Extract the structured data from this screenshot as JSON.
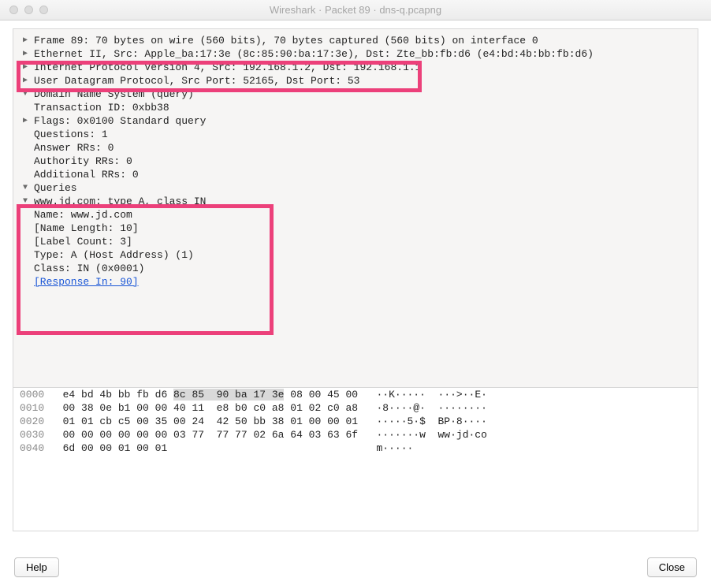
{
  "window": {
    "title": "Wireshark · Packet 89 · dns-q.pcapng"
  },
  "tree": {
    "frame": "Frame 89: 70 bytes on wire (560 bits), 70 bytes captured (560 bits) on interface 0",
    "eth": "Ethernet II, Src: Apple_ba:17:3e (8c:85:90:ba:17:3e), Dst: Zte_bb:fb:d6 (e4:bd:4b:bb:fb:d6)",
    "ip": "Internet Protocol Version 4, Src: 192.168.1.2, Dst: 192.168.1.1",
    "udp": "User Datagram Protocol, Src Port: 52165, Dst Port: 53",
    "dns": "Domain Name System (query)",
    "dns_txn": "Transaction ID: 0xbb38",
    "dns_flags": "Flags: 0x0100 Standard query",
    "dns_qcount": "Questions: 1",
    "dns_ancount": "Answer RRs: 0",
    "dns_nscount": "Authority RRs: 0",
    "dns_arcount": "Additional RRs: 0",
    "dns_queries": "Queries",
    "dns_q_summary": "www.jd.com: type A, class IN",
    "dns_q_name": "Name: www.jd.com",
    "dns_q_namelen": "[Name Length: 10]",
    "dns_q_labelcnt": "[Label Count: 3]",
    "dns_q_type": "Type: A (Host Address) (1)",
    "dns_q_class": "Class: IN (0x0001)",
    "dns_resp_in": "[Response In: 90]"
  },
  "hex": {
    "lines": [
      {
        "offset": "0000",
        "hex": "e4 bd 4b bb fb d6 8c 85  90 ba 17 3e 08 00 45 00",
        "ascii": "··K·····  ···>··E·",
        "sel": [
          18,
          35
        ]
      },
      {
        "offset": "0010",
        "hex": "00 38 0e b1 00 00 40 11  e8 b0 c0 a8 01 02 c0 a8",
        "ascii": "·8····@·  ········"
      },
      {
        "offset": "0020",
        "hex": "01 01 cb c5 00 35 00 24  42 50 bb 38 01 00 00 01",
        "ascii": "·····5·$  BP·8····"
      },
      {
        "offset": "0030",
        "hex": "00 00 00 00 00 00 03 77  77 77 02 6a 64 03 63 6f",
        "ascii": "·······w  ww·jd·co"
      },
      {
        "offset": "0040",
        "hex": "6d 00 00 01 00 01",
        "ascii": "m·····"
      }
    ]
  },
  "footer": {
    "help": "Help",
    "close": "Close"
  }
}
